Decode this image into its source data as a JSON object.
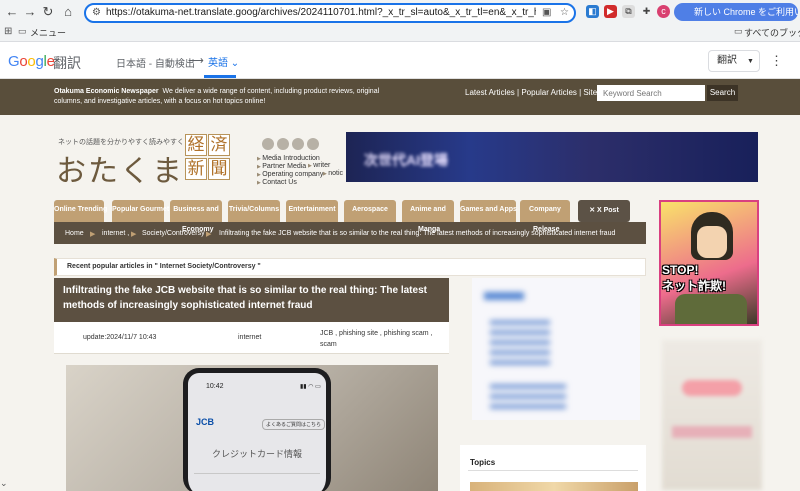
{
  "browser": {
    "url": "https://otakuma-net.translate.goog/archives/2024110701.html?_x_tr_sl=auto&_x_tr_tl=en&_x_tr_hl=ja&_x_tr_pto=wapp",
    "new_chrome_label": "新しい Chrome をご利用いただけます",
    "profile_initial": "c"
  },
  "bookmarks": {
    "menu": "メニュー",
    "all": "すべてのブックマーク"
  },
  "translate": {
    "logo": {
      "part1": "G",
      "part2": "o",
      "part3": "o",
      "part4": "g",
      "part5": "l",
      "part6": "e"
    },
    "honyaku": "翻訳",
    "source_lang": "日本語 - 自動検出",
    "arrow": "⟶",
    "target_lang": "英語",
    "target_select": "翻訳"
  },
  "site": {
    "name": "Otakuma Economic Newspaper",
    "description": "We deliver a wide range of content, including product reviews, original columns, and investigative articles, with a focus on hot topics online!",
    "links": "Latest Articles | Popular Articles | Sitemap",
    "search_placeholder": "Keyword Search",
    "search_button": "Search",
    "tagline": "ネットの話題を分かりやすく読みやすく",
    "logo_kana": "おたくま",
    "logo_kanji": [
      "経",
      "済",
      "新",
      "聞"
    ],
    "info_links": [
      "Media Introduction",
      "Partner Media",
      "Operating company",
      "Contact Us",
      "writer",
      "notic"
    ],
    "banner_text": "次世代AI登場"
  },
  "nav": {
    "tabs": [
      "Online Trending",
      "Popular Gourmet",
      "Business and",
      "Trivia/Columns",
      "Entertainment",
      "Aerospace",
      "Anime and",
      "Games and Apps",
      "Company"
    ],
    "subs": [
      "Economy",
      "Manga",
      "Release"
    ],
    "xpost": "X Post"
  },
  "breadcrumb": {
    "items": [
      "Home",
      "internet ,",
      "Society/Controversy",
      "Infiltrating the fake JCB website that is so similar to the real thing: The latest methods of increasingly sophisticated internet fraud"
    ]
  },
  "recent": {
    "text": "Recent popular articles in \" Internet Society/Controversy \""
  },
  "article": {
    "title": "Infiltrating the fake JCB website that is so similar to the real thing: The latest methods of increasingly sophisticated internet fraud",
    "update_label": "update:",
    "update_value": "2024/11/7 10:43",
    "category": "internet",
    "tags": "JCB , phishing site , phishing scam , scam",
    "phone_time": "10:42",
    "phone_brand": "JCB",
    "phone_text": "クレジットカード情報",
    "phone_hint": "よくあるご質問はこちら"
  },
  "sidebar": {
    "topics_title": "Topics",
    "stop_ad_line1": "STOP!",
    "stop_ad_line2": "ネット詐欺!"
  }
}
